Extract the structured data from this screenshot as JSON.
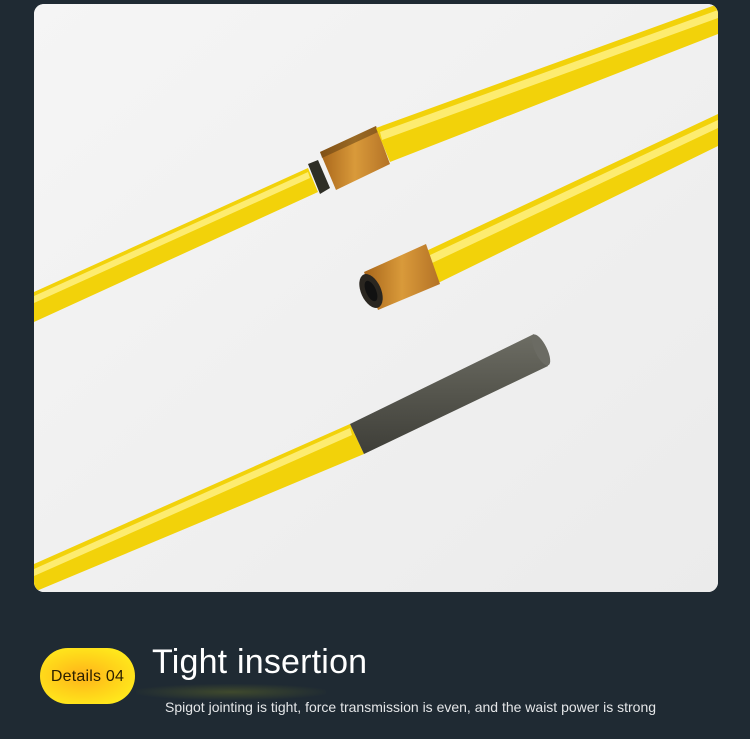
{
  "badge": {
    "label": "Details 04"
  },
  "title": "Tight insertion",
  "subtitle": "Spigot jointing is tight, force transmission is even, and the waist power is strong",
  "photo": {
    "icon": "fishing-rod-sections-photo"
  },
  "colors": {
    "page_background": "#1f2a33",
    "rod_yellow": "#f5d80a",
    "badge_yellow": "#ffe31c",
    "badge_center": "#ffb21a",
    "thread_wrap": "#c88a2a",
    "carbon_spigot": "#5a5a52"
  }
}
